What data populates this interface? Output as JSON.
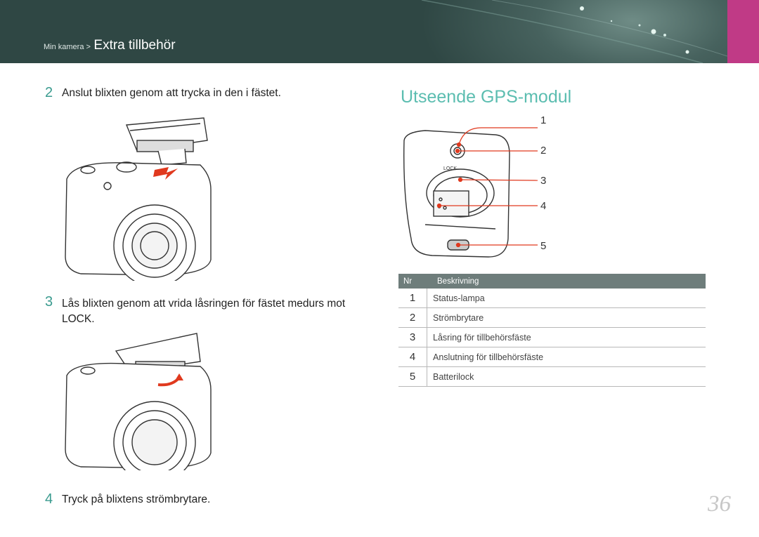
{
  "header": {
    "breadcrumb_prefix": "Min kamera >",
    "breadcrumb_title": "Extra tillbehör"
  },
  "colors": {
    "accent": "#c03a86",
    "heading": "#5bbdb0",
    "step_number": "#3a9b8f",
    "table_header": "#6e7d7b",
    "arrow": "#e0391e"
  },
  "steps": [
    {
      "num": "2",
      "text": "Anslut blixten genom att trycka in den i fästet."
    },
    {
      "num": "3",
      "text": "Lås blixten genom att vrida låsringen för fästet medurs mot LOCK."
    },
    {
      "num": "4",
      "text": "Tryck på blixtens strömbrytare."
    }
  ],
  "section": {
    "title": "Utseende GPS-modul",
    "lock_label": "LOCK",
    "callouts": [
      "1",
      "2",
      "3",
      "4",
      "5"
    ]
  },
  "table": {
    "headers": [
      "Nr",
      "Beskrivning"
    ],
    "rows": [
      [
        "1",
        "Status-lampa"
      ],
      [
        "2",
        "Strömbrytare"
      ],
      [
        "3",
        "Låsring för tillbehörsfäste"
      ],
      [
        "4",
        "Anslutning för tillbehörsfäste"
      ],
      [
        "5",
        "Batterilock"
      ]
    ]
  },
  "page_number": "36"
}
